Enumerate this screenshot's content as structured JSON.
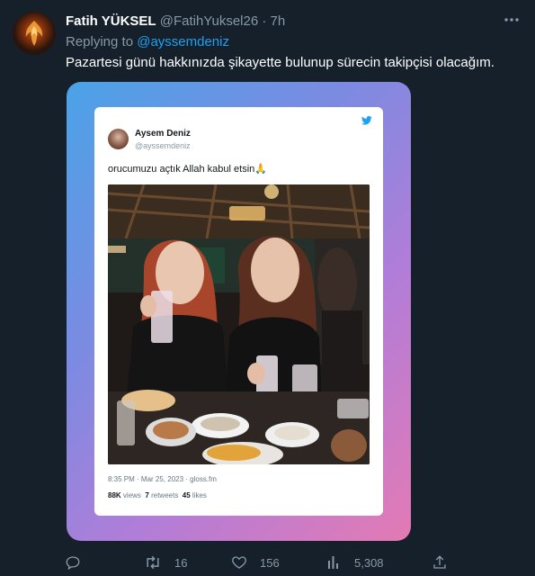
{
  "tweet": {
    "author_name": "Fatih YÜKSEL",
    "author_handle": "@FatihYuksel26",
    "separator": "·",
    "time": "7h",
    "replying_prefix": "Replying to",
    "replying_handle": "@ayssemdeniz",
    "text": "Pazartesi günü hakkınızda şikayette bulunup sürecin takipçisi olacağım."
  },
  "embedded_card": {
    "author_name": "Aysem Deniz",
    "author_handle": "@ayssemdeniz",
    "text": "orucumuzu açtık Allah kabul etsin🙏",
    "meta": "8:35 PM · Mar 25, 2023 · gloss.fm",
    "stats": {
      "views_value": "88K",
      "views_label": "views",
      "retweets_value": "7",
      "retweets_label": "retweets",
      "likes_value": "45",
      "likes_label": "likes"
    }
  },
  "actions": {
    "reply_count": "",
    "retweet_count": "16",
    "like_count": "156",
    "views_count": "5,308"
  },
  "colors": {
    "background": "#15202b",
    "secondary_text": "#8899a6",
    "accent": "#1da1f2"
  }
}
